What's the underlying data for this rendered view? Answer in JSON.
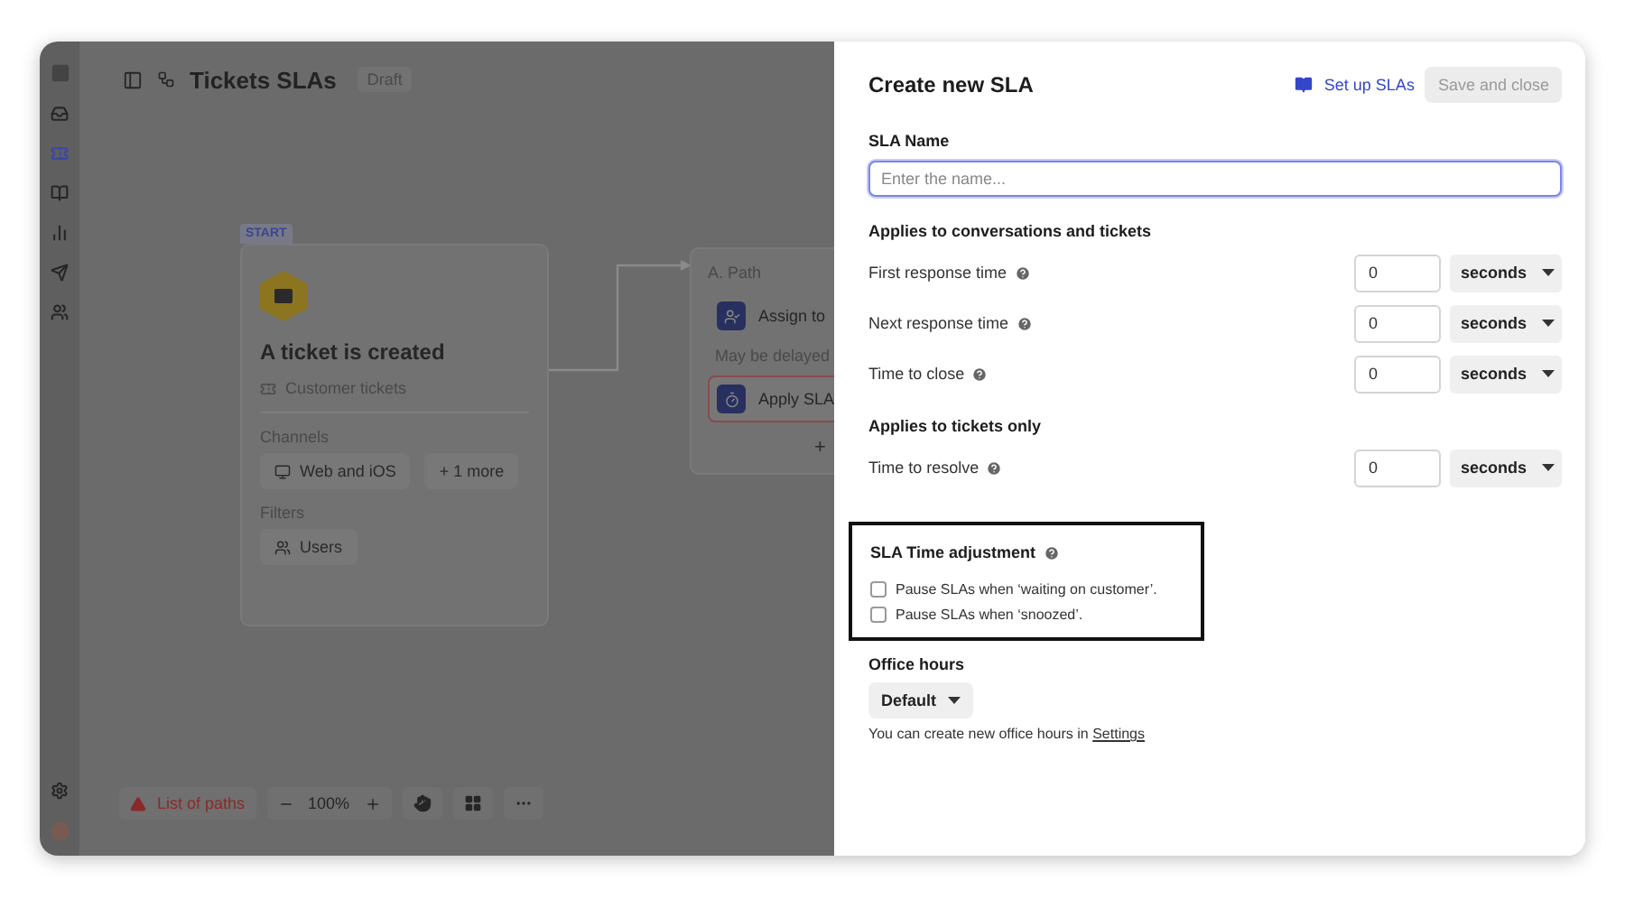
{
  "sidebar": {
    "items": [
      {
        "selected": false
      },
      {
        "selected": true
      },
      {
        "selected": false
      },
      {
        "selected": false
      },
      {
        "selected": false
      },
      {
        "selected": false
      }
    ]
  },
  "header": {
    "title": "Tickets SLAs",
    "badge": "Draft"
  },
  "canvas": {
    "start_node": {
      "tag": "START",
      "title": "A ticket is created",
      "subtitle": "Customer tickets",
      "channels_label": "Channels",
      "channels": [
        "Web and iOS",
        "+ 1 more"
      ],
      "filters_label": "Filters",
      "filters": [
        "Users"
      ]
    },
    "path_node": {
      "title": "A. Path",
      "steps": [
        {
          "label": "Assign to",
          "note": "May be delayed",
          "highlighted": false
        },
        {
          "label": "Apply SLA",
          "highlighted": true
        }
      ],
      "add": "+"
    }
  },
  "toolbar": {
    "warning": "List of paths",
    "zoom": "100%"
  },
  "panel": {
    "title": "Create new SLA",
    "help_link": "Set up SLAs",
    "save_button": {
      "label": "Save and close",
      "disabled": true
    },
    "name_field": {
      "label": "SLA Name",
      "placeholder": "Enter the name...",
      "focused": true
    },
    "sections": [
      {
        "title": "Applies to conversations and tickets",
        "rows": [
          {
            "label": "First response time",
            "value": "0",
            "unit": "seconds"
          },
          {
            "label": "Next response time",
            "value": "0",
            "unit": "seconds"
          },
          {
            "label": "Time to close",
            "value": "0",
            "unit": "seconds"
          }
        ]
      },
      {
        "title": "Applies to tickets only",
        "rows": [
          {
            "label": "Time to resolve",
            "value": "0",
            "unit": "seconds"
          }
        ]
      }
    ],
    "adjustment": {
      "title": "SLA Time adjustment",
      "highlighted": true,
      "options": [
        {
          "label": "Pause SLAs when ‘waiting on customer’.",
          "checked": false
        },
        {
          "label": "Pause SLAs when ‘snoozed’.",
          "checked": false
        }
      ]
    },
    "office_hours": {
      "label": "Office hours",
      "select": "Default",
      "note": "You can create new office hours in",
      "link": "Settings"
    }
  }
}
